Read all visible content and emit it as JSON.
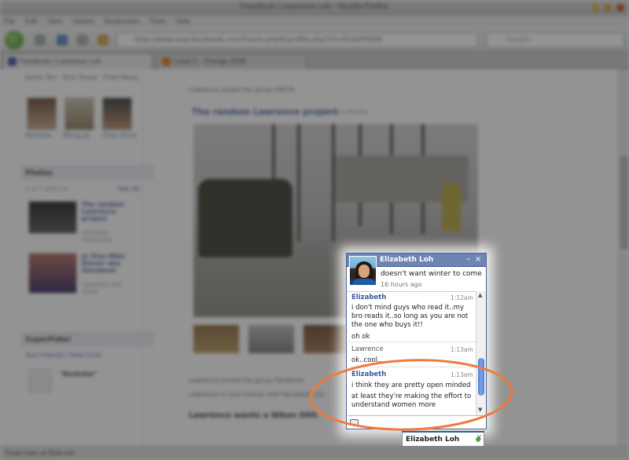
{
  "browser": {
    "title": "Facebook | Lawrence Loh - Mozilla Firefox",
    "menu": [
      "File",
      "Edit",
      "View",
      "History",
      "Bookmarks",
      "Tools",
      "Help"
    ],
    "url": "http://www.new.facebook.com/home.php#/profile.php?id=614455094",
    "search_placeholder": "Google",
    "tabs": [
      {
        "label": "Facebook | Lawrence Loh"
      },
      {
        "label": "Local C - Orange 2008"
      }
    ],
    "status_text": "Read mais at flickr.net"
  },
  "profile": {
    "friends": [
      "Jackie Tan",
      "Rich Young",
      "Chee Meng"
    ],
    "friends_row2": [
      "Michelle",
      "Wong Jie",
      "Chen Shue"
    ],
    "photos_box_title": "Photos",
    "photos_count": "1 of 7 albums",
    "see_all": "See All",
    "albums": [
      {
        "title": "The random Lawrence project",
        "sub": "Updated Yesterday"
      },
      {
        "title": "Jo Xiao Mike Dinner aka Hanabeet",
        "sub": "Updated last week"
      }
    ],
    "superpoke_title": "SuperPoke!",
    "superpoke_links": "Your Friends | Poke Fund",
    "superpoke_item": "\"Rockstar\"",
    "feed_top": "Lawrence joined the group UHCPL",
    "post_title": "The random Lawrence project",
    "post_sub": "1 new photos",
    "feed_items": [
      "Lawrence joined the group Facebook",
      "Lawrence is now friends with Facebook Ltd",
      "Lawrence wants a Nikon D90."
    ]
  },
  "chat": {
    "name": "Elizabeth Loh",
    "status": "doesn't want winter to come..",
    "status_time": "16 hours ago",
    "messages": [
      {
        "sender": "Elizabeth",
        "time": "1:12am",
        "lines": [
          "i don't mind guys who read it..my",
          "bro reads it..so long as you are not",
          "the one who buys it!!",
          "oh ok"
        ]
      },
      {
        "sender": "Lawrence",
        "time": "1:13am",
        "lines": [
          "ok..cool.."
        ]
      },
      {
        "sender": "Elizabeth",
        "time": "1:13am",
        "lines": [
          "i think they are pretty open minded",
          "at least they're making the effort to",
          "understand women more"
        ]
      }
    ],
    "tab_label": "Elizabeth Loh",
    "minimize": "–",
    "close": "×",
    "close_tab": "×"
  },
  "colors": {
    "fb_blue": "#3b5998",
    "chat_header": "#6d84b4",
    "annotation": "#f07a3c",
    "online": "#42b72a"
  }
}
